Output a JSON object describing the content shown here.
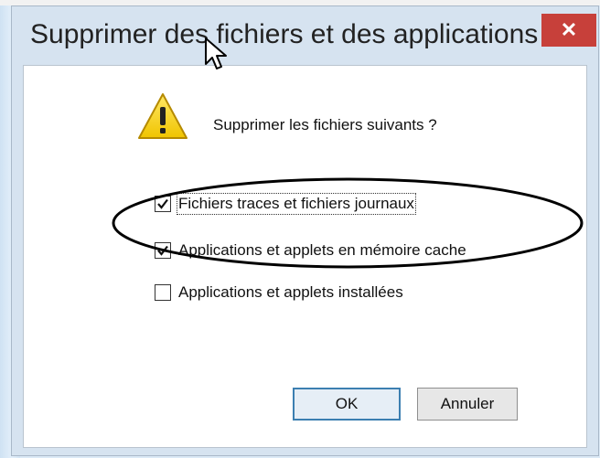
{
  "dialog": {
    "title": "Supprimer des fichiers et des applications",
    "close_glyph": "✕",
    "question": "Supprimer les fichiers suivants ?",
    "icon": "warning-icon",
    "options": [
      {
        "label": "Fichiers traces et fichiers journaux",
        "checked": true
      },
      {
        "label": "Applications et applets en mémoire cache",
        "checked": true
      },
      {
        "label": "Applications et applets installées",
        "checked": false
      }
    ],
    "buttons": {
      "ok": "OK",
      "cancel": "Annuler"
    }
  },
  "colors": {
    "close_bg": "#c7403a",
    "warning_yellow": "#f5d400",
    "focus_border": "#3c7fb1"
  }
}
